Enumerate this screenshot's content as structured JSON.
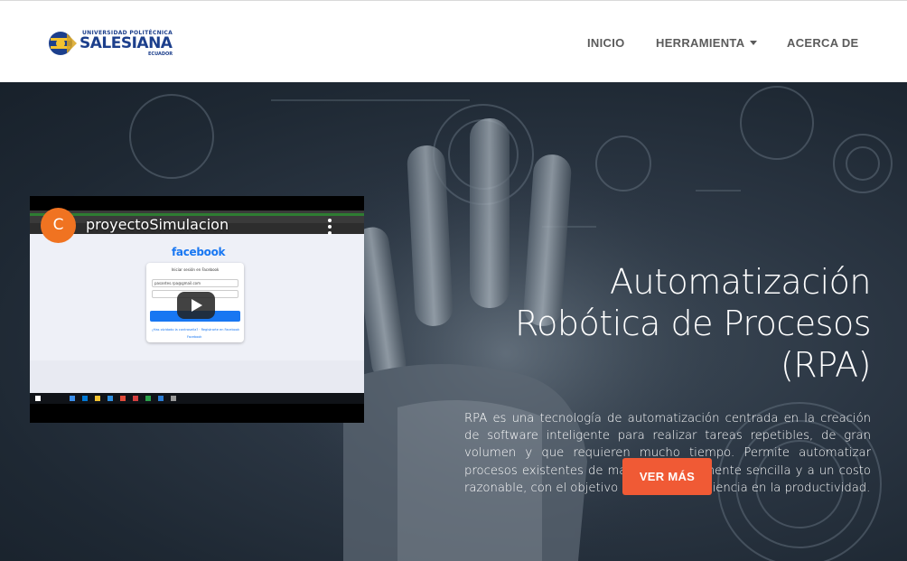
{
  "brand": {
    "line1": "UNIVERSIDAD POLITÉCNICA",
    "line2": "SALESIANA",
    "line3": "ECUADOR"
  },
  "nav": {
    "items": [
      "INICIO",
      "HERRAMIENTA",
      "ACERCA DE"
    ]
  },
  "video": {
    "channel_initial": "C",
    "title": "proyectoSimulacion",
    "page_logo": "facebook",
    "card_heading": "Iniciar sesión en Facebook",
    "card_email": "pasantes.rpa@gmail.com",
    "card_link1": "¿Has olvidado la contraseña? · Registrarte en Facebook",
    "card_link2": "Facebook"
  },
  "hero": {
    "title_lines": [
      "Automatización",
      "Robótica de Procesos",
      "(RPA)"
    ],
    "description": "RPA es una tecnología de automatización centrada en la creación de software inteligente para realizar tareas repetibles, de gran volumen y que requieren mucho tiempo. Permite automatizar procesos existentes de manera relativamente sencilla y a un costo razonable, con el objetivo de obtener eficiencia en la productividad.",
    "button_label": "VER MÁS"
  },
  "colors": {
    "accent": "#f05a35",
    "brand_blue": "#1c3f8c",
    "hero_bg": "#2b3643"
  },
  "icons": [
    "play-icon",
    "kebab-menu-icon",
    "caret-down-icon",
    "ups-emblem-icon"
  ]
}
